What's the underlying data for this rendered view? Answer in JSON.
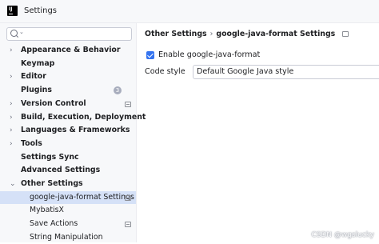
{
  "window": {
    "title": "Settings"
  },
  "search": {
    "placeholder": ""
  },
  "sidebar": {
    "items": [
      {
        "label": "Appearance & Behavior",
        "expandable": true,
        "bold": true
      },
      {
        "label": "Keymap",
        "expandable": false,
        "bold": true
      },
      {
        "label": "Editor",
        "expandable": true,
        "bold": true
      },
      {
        "label": "Plugins",
        "expandable": false,
        "bold": true,
        "badge": "3"
      },
      {
        "label": "Version Control",
        "expandable": true,
        "bold": true,
        "project_icon": true
      },
      {
        "label": "Build, Execution, Deployment",
        "expandable": true,
        "bold": true
      },
      {
        "label": "Languages & Frameworks",
        "expandable": true,
        "bold": true
      },
      {
        "label": "Tools",
        "expandable": true,
        "bold": true
      },
      {
        "label": "Settings Sync",
        "expandable": false,
        "bold": true
      },
      {
        "label": "Advanced Settings",
        "expandable": false,
        "bold": true
      },
      {
        "label": "Other Settings",
        "expandable": true,
        "expanded": true,
        "bold": true
      },
      {
        "label": "google-java-format Settings",
        "child": true,
        "selected": true,
        "project_icon": true
      },
      {
        "label": "MybatisX",
        "child": true
      },
      {
        "label": "Save Actions",
        "child": true,
        "project_icon": true
      },
      {
        "label": "String Manipulation",
        "child": true
      }
    ]
  },
  "main": {
    "breadcrumb": {
      "parent": "Other Settings",
      "separator": "›",
      "current": "google-java-format Settings"
    },
    "enable_checkbox": {
      "label": "Enable google-java-format",
      "checked": true
    },
    "code_style": {
      "label": "Code style",
      "value": "Default Google Java style"
    }
  },
  "watermark": "CSDN @wgslucky",
  "colors": {
    "selection": "#d5e1f7",
    "accent": "#3574f0"
  }
}
